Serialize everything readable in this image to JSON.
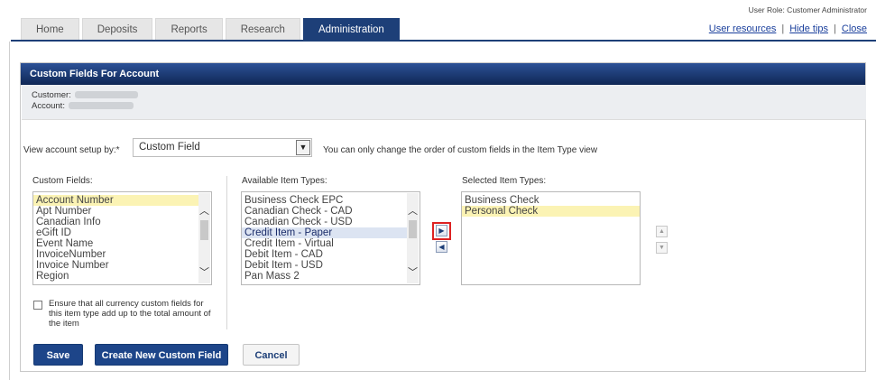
{
  "tabs": [
    {
      "label": "Home",
      "active": false
    },
    {
      "label": "Deposits",
      "active": false
    },
    {
      "label": "Reports",
      "active": false
    },
    {
      "label": "Research",
      "active": false
    },
    {
      "label": "Administration",
      "active": true
    }
  ],
  "header": {
    "user_role": "User Role: Customer Administrator",
    "links": [
      "User resources",
      "Hide tips",
      "Close"
    ]
  },
  "panel": {
    "title": "Custom Fields For Account",
    "customer_label": "Customer:",
    "account_label": "Account:"
  },
  "view": {
    "label": "View account setup by:*",
    "selected": "Custom Field",
    "note": "You can only change the order of custom fields in the Item Type view"
  },
  "custom_fields": {
    "label": "Custom Fields:",
    "items": [
      "Account Number",
      "Apt Number",
      "Canadian Info",
      "eGift ID",
      "Event Name",
      "InvoiceNumber",
      "Invoice Number",
      "Region"
    ],
    "highlighted": "Account Number"
  },
  "available_item_types": {
    "label": "Available Item Types:",
    "items": [
      "Business Check EPC",
      "Canadian Check - CAD",
      "Canadian Check - USD",
      "Credit Item - Paper",
      "Credit Item - Virtual",
      "Debit Item - CAD",
      "Debit Item - USD",
      "Pan Mass 2"
    ],
    "selected": "Credit Item - Paper"
  },
  "selected_item_types": {
    "label": "Selected Item Types:",
    "items": [
      "Business Check",
      "Personal Check"
    ],
    "highlighted": "Personal Check"
  },
  "currency_checkbox": {
    "label": "Ensure that all currency custom fields for this item type add up to the total amount of the item",
    "checked": false
  },
  "buttons": {
    "save": "Save",
    "create": "Create New Custom Field",
    "cancel": "Cancel"
  },
  "colors": {
    "accent": "#1d3f78",
    "highlight": "#fbf3b4",
    "selection": "#dce4f2",
    "callout": "#dd2222"
  }
}
